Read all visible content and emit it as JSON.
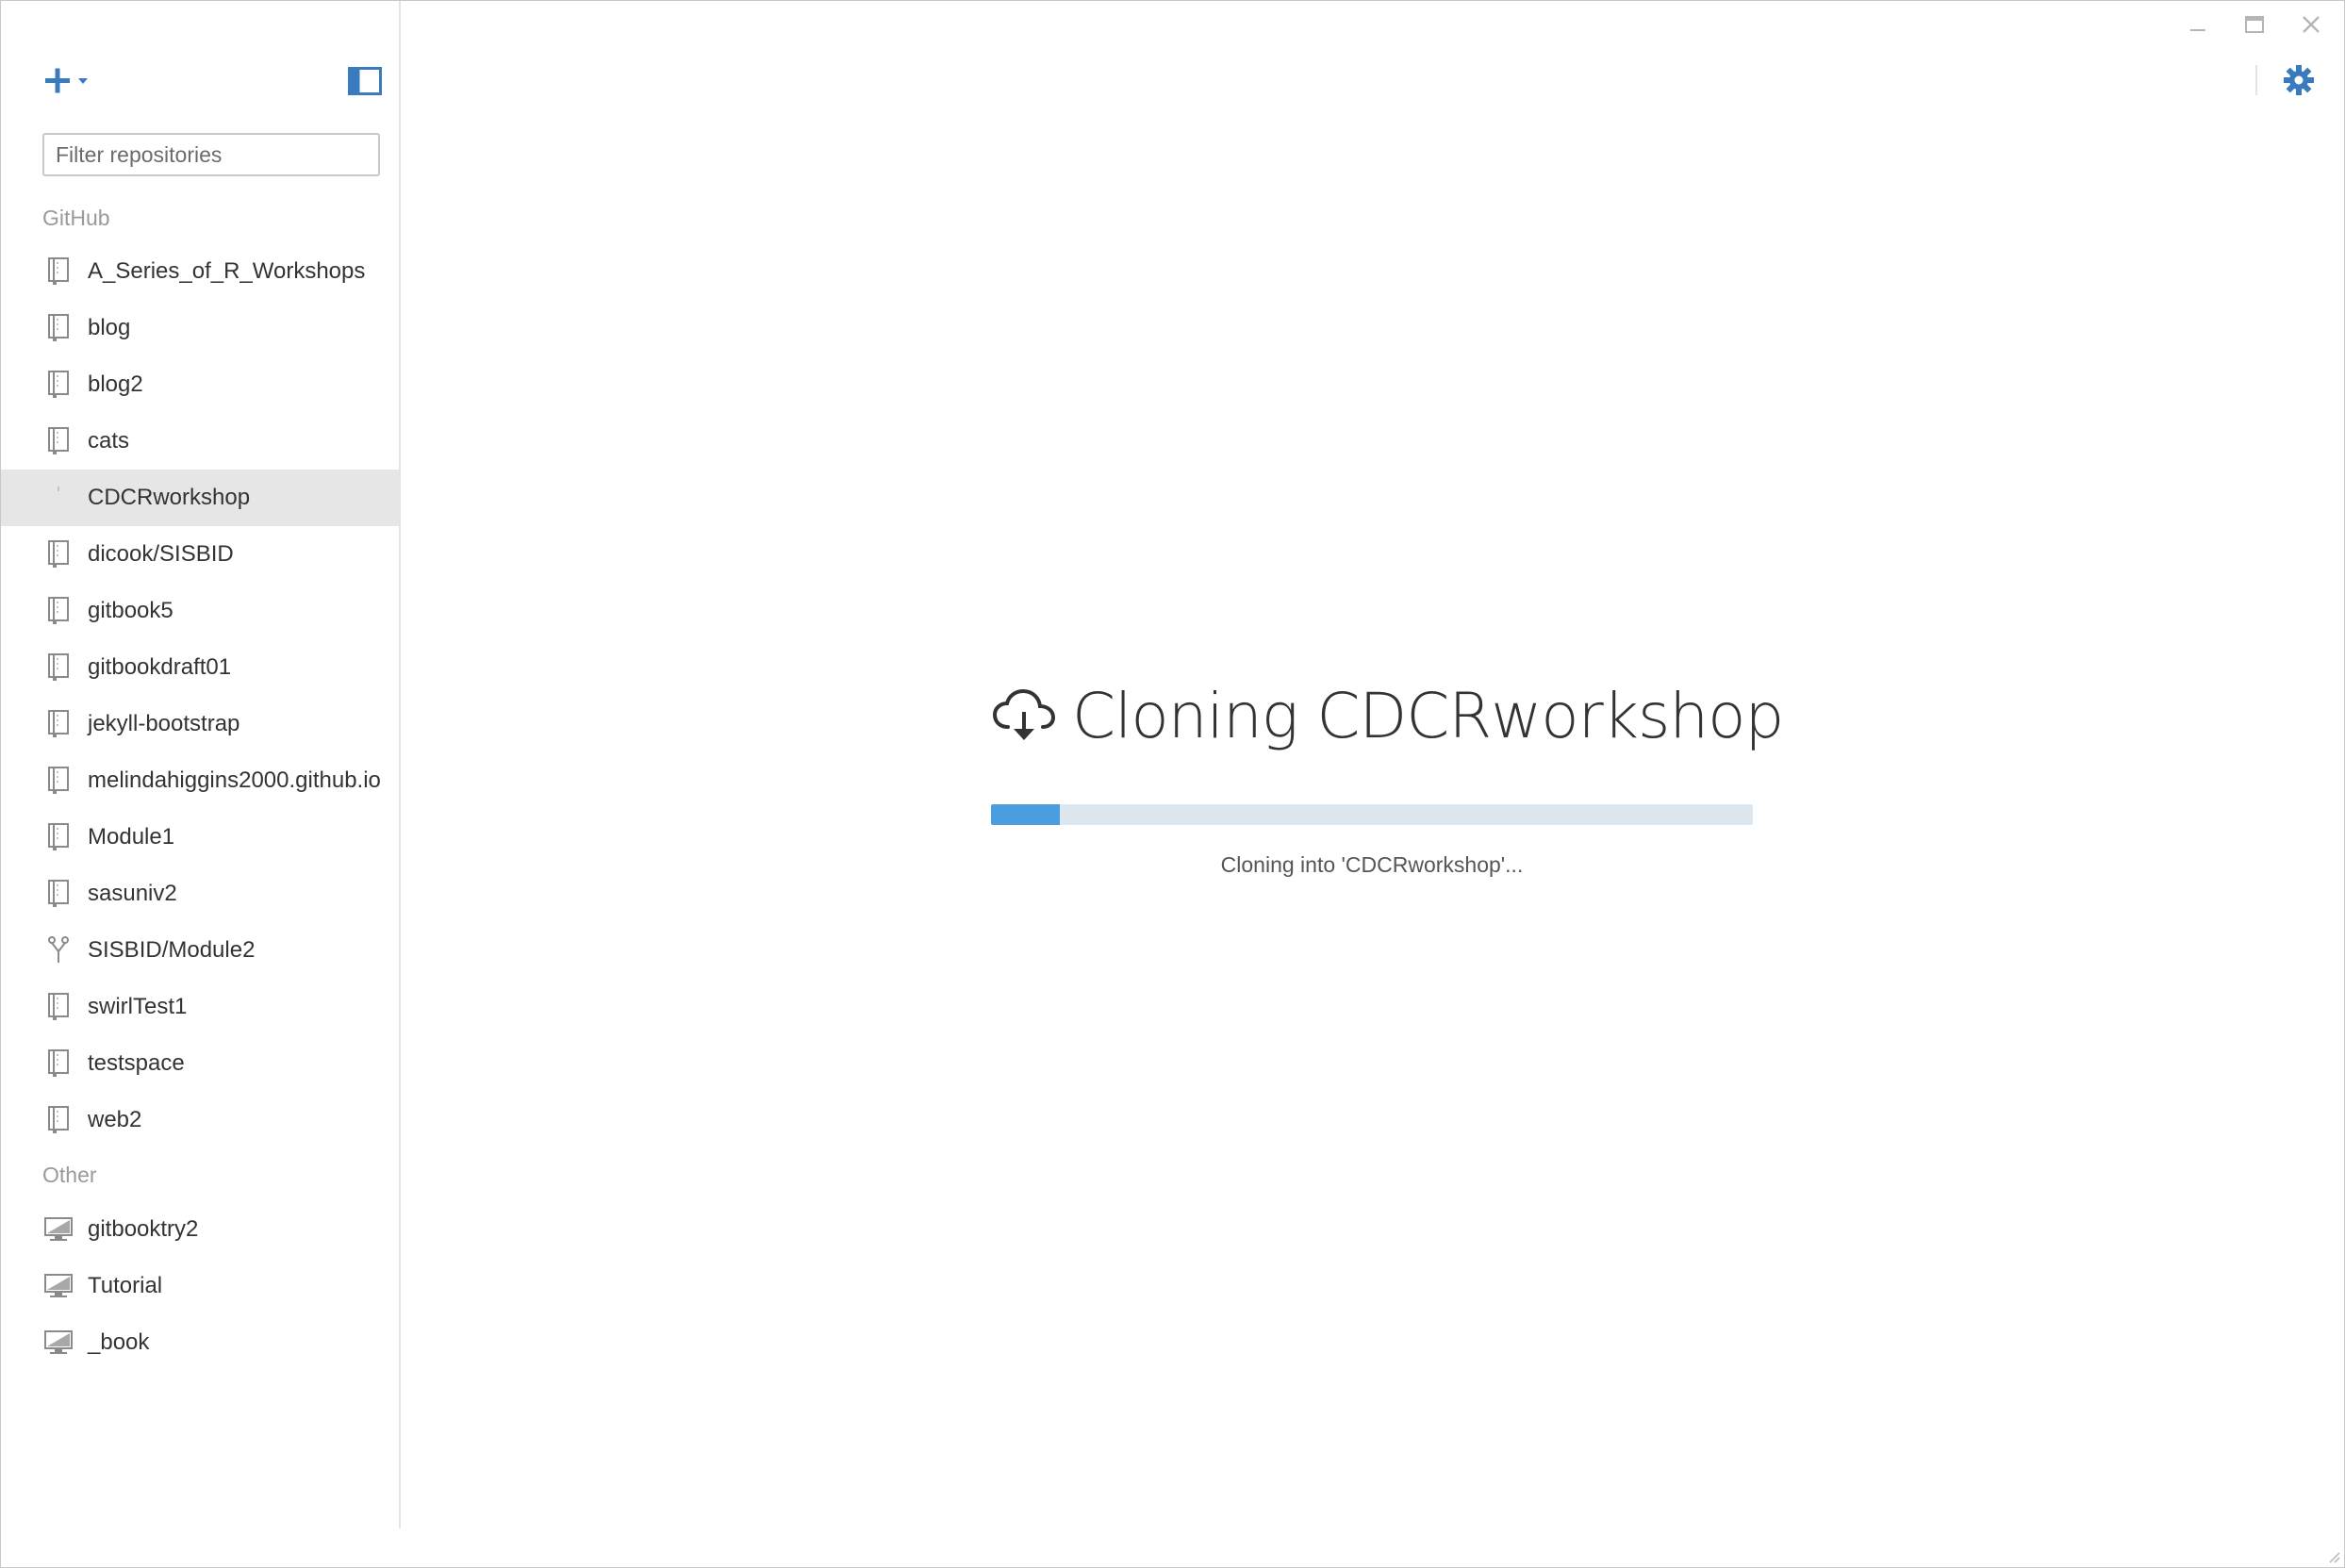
{
  "window": {
    "controls": {
      "minimize_icon": "minimize-icon",
      "maximize_icon": "maximize-icon",
      "close_icon": "close-icon"
    }
  },
  "sidebar": {
    "add_icon": "plus-icon",
    "toggle_icon": "sidebar-toggle-icon",
    "filter_placeholder": "Filter repositories",
    "sections": [
      {
        "label": "GitHub",
        "items": [
          {
            "label": "A_Series_of_R_Workshops",
            "icon": "repo-icon"
          },
          {
            "label": "blog",
            "icon": "repo-icon"
          },
          {
            "label": "blog2",
            "icon": "repo-icon"
          },
          {
            "label": "cats",
            "icon": "repo-icon"
          },
          {
            "label": "CDCRworkshop",
            "icon": "cloning-icon",
            "selected": true
          },
          {
            "label": "dicook/SISBID",
            "icon": "repo-icon"
          },
          {
            "label": "gitbook5",
            "icon": "repo-icon"
          },
          {
            "label": "gitbookdraft01",
            "icon": "repo-icon"
          },
          {
            "label": "jekyll-bootstrap",
            "icon": "repo-icon"
          },
          {
            "label": "melindahiggins2000.github.io",
            "icon": "repo-icon"
          },
          {
            "label": "Module1",
            "icon": "repo-icon"
          },
          {
            "label": "sasuniv2",
            "icon": "repo-icon"
          },
          {
            "label": "SISBID/Module2",
            "icon": "fork-icon"
          },
          {
            "label": "swirlTest1",
            "icon": "repo-icon"
          },
          {
            "label": "testspace",
            "icon": "repo-icon"
          },
          {
            "label": "web2",
            "icon": "repo-icon"
          }
        ]
      },
      {
        "label": "Other",
        "items": [
          {
            "label": "gitbooktry2",
            "icon": "computer-icon"
          },
          {
            "label": "Tutorial",
            "icon": "computer-icon"
          },
          {
            "label": "_book",
            "icon": "computer-icon"
          }
        ]
      }
    ]
  },
  "main": {
    "settings_icon": "gear-icon",
    "clone": {
      "icon": "cloud-download-icon",
      "title": "Cloning CDCRworkshop",
      "progress": 0.09,
      "status": "Cloning into 'CDCRworkshop'..."
    }
  },
  "colors": {
    "accent": "#3a7bbf",
    "progress_fill": "#4a9ee0",
    "progress_track": "#dde7f0",
    "selected_row": "#e6e6e6"
  }
}
